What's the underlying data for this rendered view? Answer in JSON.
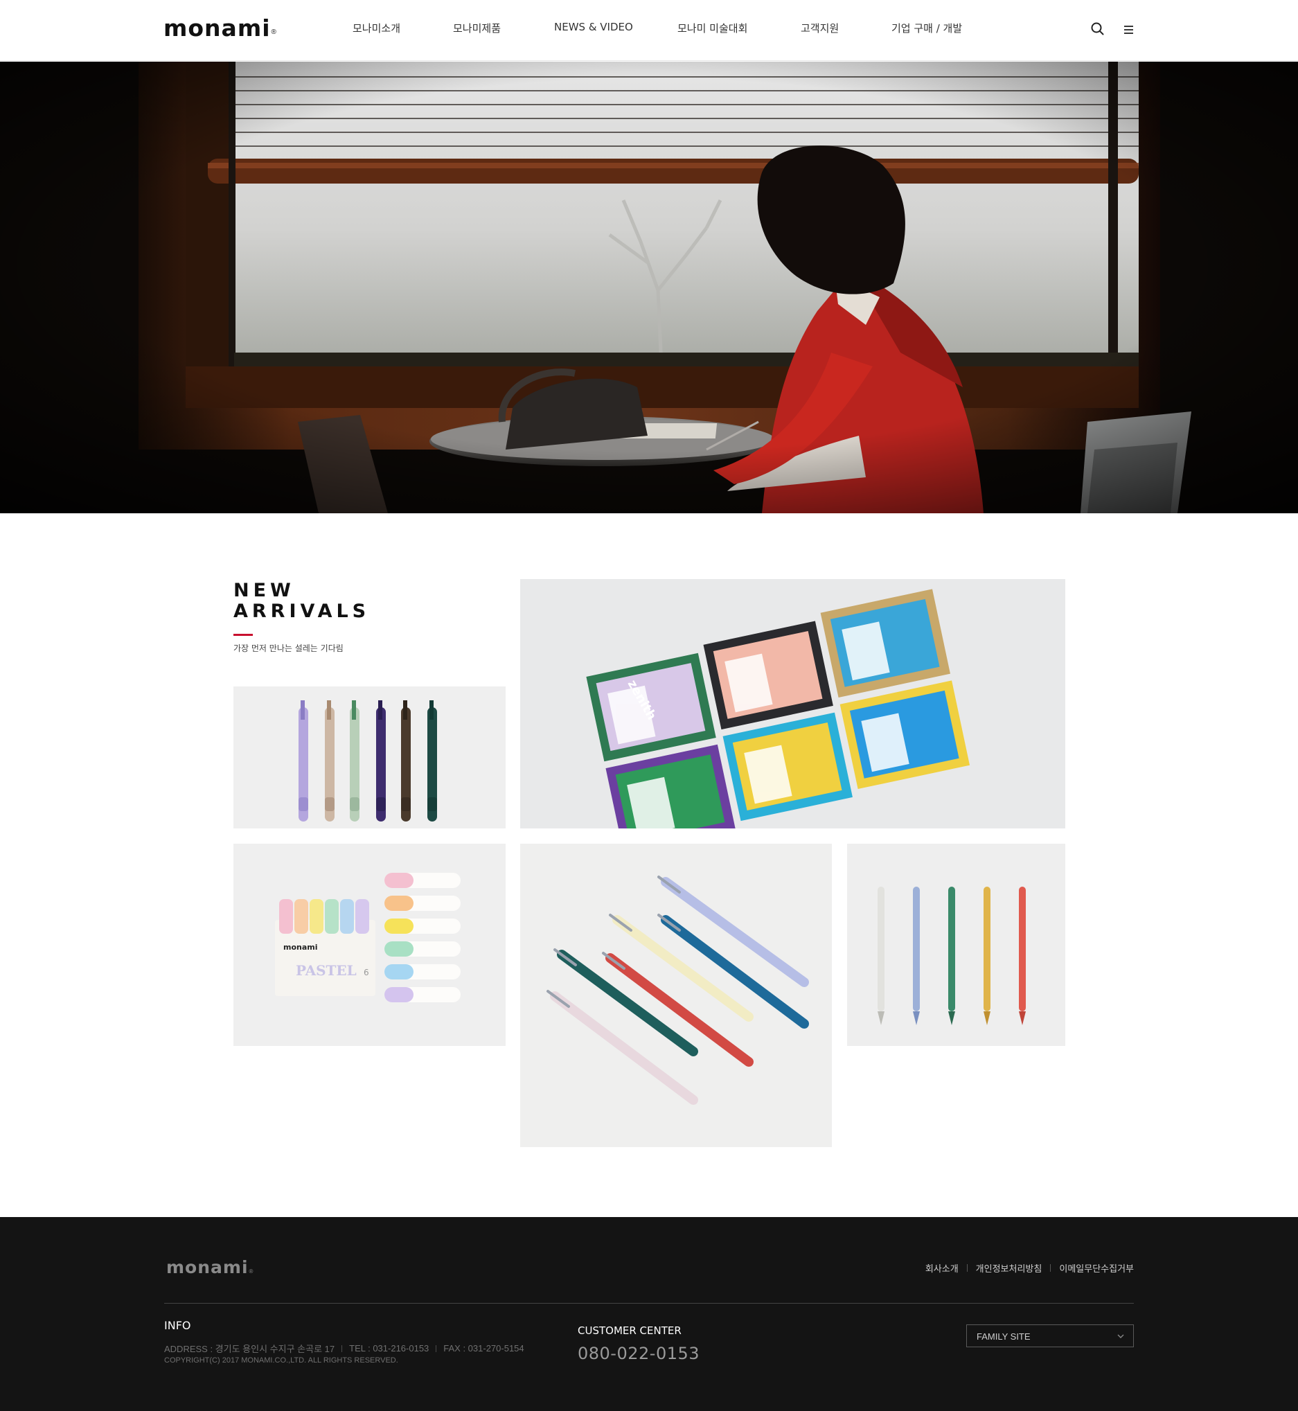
{
  "header": {
    "logo": "monami",
    "nav": [
      "모나미소개",
      "모나미제품",
      "NEWS & VIDEO",
      "모나미 미술대회",
      "고객지원",
      "기업 구매 / 개발"
    ],
    "icons": [
      "search-icon",
      "menu-icon"
    ]
  },
  "hero": {
    "image": "woman-writing-by-window"
  },
  "new_arrivals": {
    "title_line1": "NEW",
    "title_line2": "ARRIVALS",
    "subtitle": "가장 먼저 만나는 설레는 기다림",
    "accent": "#c8102e",
    "products": [
      {
        "name": "multi-color-pens",
        "image": "pens"
      },
      {
        "name": "zenith-gift-sets",
        "image": "gift-sets",
        "label": "zenith"
      },
      {
        "name": "pastel-highlighters",
        "image": "highlighters",
        "brand": "monami",
        "label": "PASTEL",
        "count": "6"
      },
      {
        "name": "ballpoint-pens",
        "image": "pens"
      },
      {
        "name": "slim-pens",
        "image": "pens"
      }
    ]
  },
  "footer": {
    "logo": "monami",
    "links": [
      "회사소개",
      "개인정보처리방침",
      "이메일무단수집거부"
    ],
    "info_heading": "INFO",
    "address": "ADDRESS : 경기도 용인시 수지구 손곡로 17",
    "tel": "TEL : 031-216-0153",
    "fax": "FAX : 031-270-5154",
    "copyright": "COPYRIGHT(C) 2017 MONAMI.CO.,LTD. ALL RIGHTS RESERVED.",
    "cc_heading": "CUSTOMER CENTER",
    "cc_phone": "080-022-0153",
    "family_site": "FAMILY SITE"
  },
  "colors": {
    "footer_bg": "#141414",
    "accent": "#c8102e"
  }
}
